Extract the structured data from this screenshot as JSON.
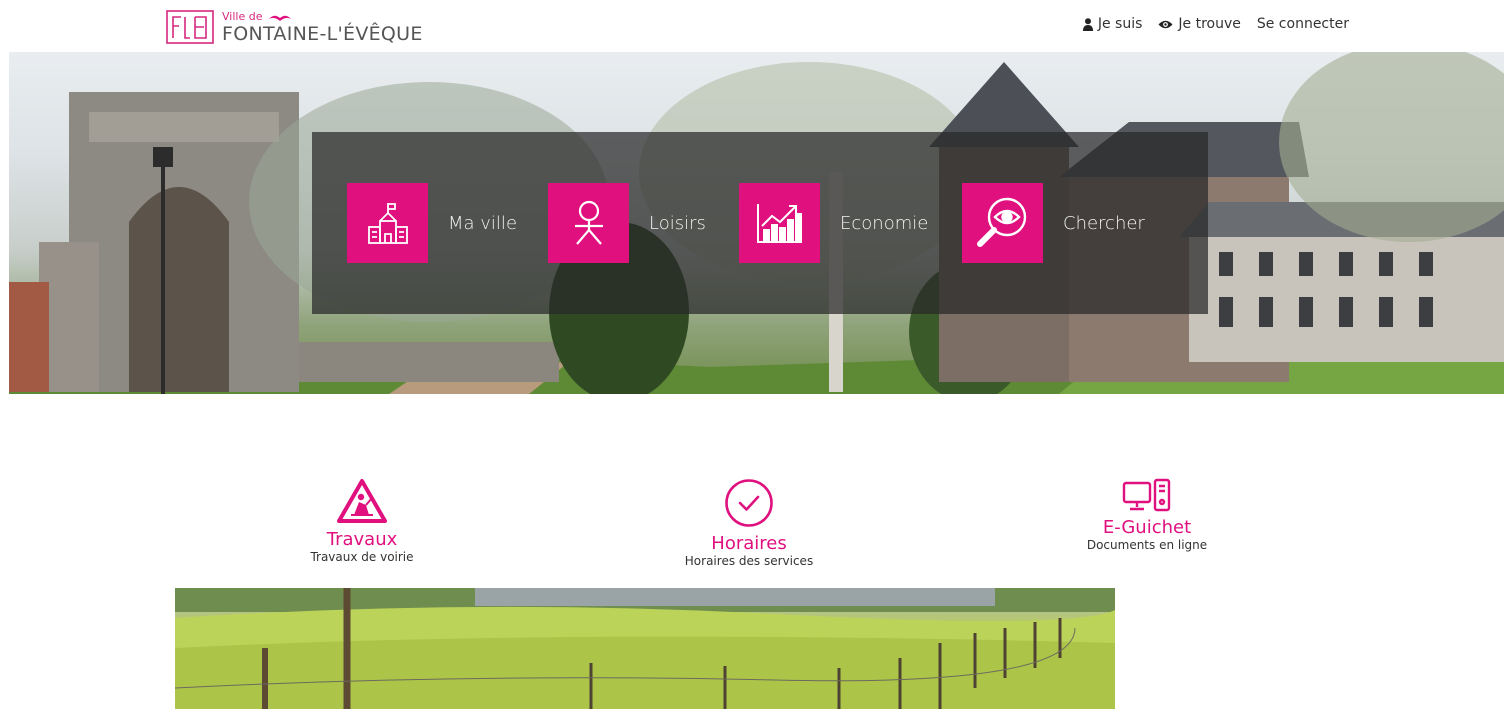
{
  "header": {
    "logo": {
      "prefix": "Ville de",
      "name": "FONTAINE-L'ÉVÊQUE",
      "mark_icon": "fle-monogram-icon"
    },
    "nav": [
      {
        "label": "Je suis",
        "icon": "user-icon"
      },
      {
        "label": "Je trouve",
        "icon": "eye-icon"
      },
      {
        "label": "Se connecter",
        "icon": ""
      }
    ]
  },
  "hero": {
    "tiles": [
      {
        "label": "Ma ville",
        "icon": "town-hall-icon"
      },
      {
        "label": "Loisirs",
        "icon": "person-leisure-icon"
      },
      {
        "label": "Economie",
        "icon": "growth-chart-icon"
      },
      {
        "label": "Chercher",
        "icon": "magnifier-eye-icon"
      }
    ]
  },
  "shortcuts": [
    {
      "title": "Travaux",
      "subtitle": "Travaux de voirie",
      "icon": "roadworks-icon"
    },
    {
      "title": "Horaires",
      "subtitle": "Horaires des services",
      "icon": "check-circle-icon"
    },
    {
      "title": "E-Guichet",
      "subtitle": "Documents en ligne",
      "icon": "computer-icon"
    }
  ],
  "colors": {
    "accent": "#e0107f",
    "overlay": "rgba(40,40,40,0.72)",
    "text": "#333333"
  }
}
